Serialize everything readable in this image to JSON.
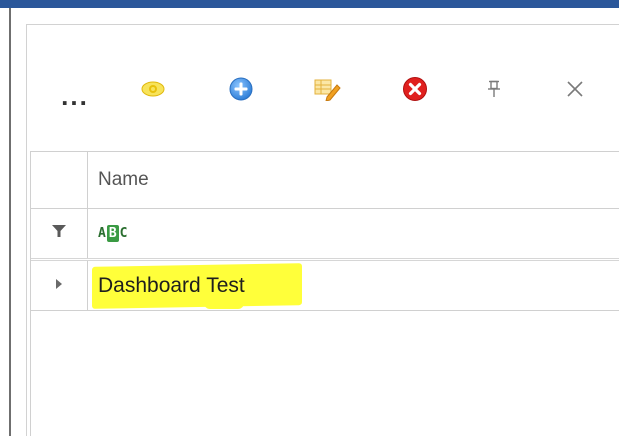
{
  "toolbar": {
    "more_label": "...",
    "icons": {
      "view": "eye-icon",
      "add": "plus-circle-icon",
      "edit": "edit-pencil-icon",
      "delete": "delete-x-circle-icon",
      "pin": "pin-icon",
      "close": "close-icon"
    },
    "colors": {
      "view": "#f2d21e",
      "add": "#3b8fe0",
      "edit": "#f0b42a",
      "delete": "#e0201e",
      "pin": "#7a7a7a",
      "close": "#7a7a7a"
    }
  },
  "grid": {
    "columns": [
      {
        "header": "Name"
      }
    ],
    "filter_row": {
      "filter_icon": "filter-icon",
      "text_filter_badge": {
        "left": "A",
        "middle": "B",
        "right": "C"
      }
    },
    "rows": [
      {
        "expand_icon": "expand-arrow-icon",
        "name": "Dashboard Test",
        "highlighted": true
      }
    ]
  },
  "window": {
    "title_bar_color": "#2b579a",
    "highlight_color": "#ffff3a"
  }
}
